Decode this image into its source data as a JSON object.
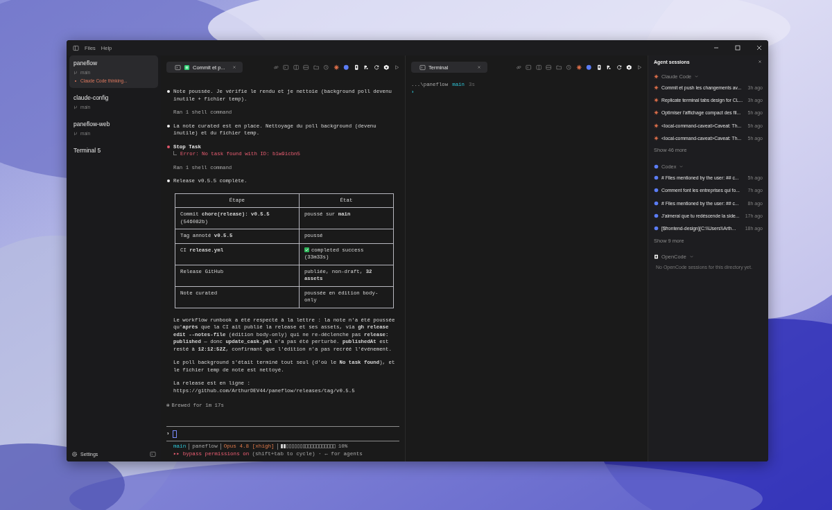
{
  "menu": [
    "Files",
    "Help"
  ],
  "sidebar": {
    "projects": [
      {
        "name": "paneflow",
        "branch": "main",
        "status": "Claude Code thinking...",
        "selected": true
      },
      {
        "name": "claude-config",
        "branch": "main",
        "selected": false
      },
      {
        "name": "paneflow-web",
        "branch": "main",
        "selected": false
      },
      {
        "name": "Terminal 5",
        "selected": false
      }
    ],
    "settings": "Settings"
  },
  "left_pane": {
    "tab": {
      "title": "Commit et p..."
    },
    "blocks": [
      {
        "kind": "message",
        "text": "Note poussée. Je vérifie le rendu et je nettoie (background poll devenu inutile + fichier temp)."
      },
      {
        "kind": "note",
        "text": "Ran 1 shell command"
      },
      {
        "kind": "message",
        "text": "La note curated est en place. Nettoyage du poll background (devenu inutile) et du fichier temp."
      },
      {
        "kind": "tool",
        "text": "Stop Task",
        "error": "Error: No task found with ID: b1w9icbn5"
      },
      {
        "kind": "note",
        "text": "Ran 1 shell command"
      },
      {
        "kind": "message",
        "text": "Release v0.5.5 complète."
      },
      {
        "kind": "table",
        "columns": [
          "Étape",
          "État"
        ],
        "rows": [
          {
            "step": "Commit **chore(release): v0.5.5** (546082b)",
            "state": "poussé sur **main**",
            "check": false
          },
          {
            "step": "Tag annoté **v0.5.5**",
            "state": "poussé",
            "check": false
          },
          {
            "step": "CI **release.yml**",
            "state": "completed success (33m33s)",
            "check": true
          },
          {
            "step": "Release GitHub",
            "state": "publiée, non-draft, **32 assets**",
            "check": false
          },
          {
            "step": "Note curated",
            "state": "poussée en édition body-only",
            "check": false
          }
        ]
      },
      {
        "kind": "paragraph",
        "text": "Le workflow runbook a été respecté à la lettre : la note n'a été poussée qu'**après** que la CI ait publié la release et ses assets, via **gh release edit --notes-file** (édition body-only) qui ne re-déclenche pas **release: published** — donc **update_cask.yml** n'a pas été perturbé. **publishedAt** est resté à **12:12:52Z**, confirmant que l'édition n'a pas recréé l'événement."
      },
      {
        "kind": "paragraph",
        "text": "Le poll background s'était terminé tout seul (d'où le **No task found**), et le fichier temp de note est nettoyé."
      },
      {
        "kind": "paragraph",
        "text": "La release est en ligne :\nhttps://github.com/ArthurDEV44/paneflow/releases/tag/v0.5.5"
      },
      {
        "kind": "brewed",
        "glyph": "✻",
        "text": "Brewed for 1m 17s"
      }
    ],
    "prompt": "›",
    "status_line": {
      "branch": "main",
      "project": "paneflow",
      "model": "Opus 4.8 [xhigh]",
      "context": {
        "level": 0.1,
        "reading": "10%"
      }
    },
    "mode_line": {
      "mode": "▸▸ bypass permissions on",
      "hint": "(shift+tab to cycle) · ← for agents"
    }
  },
  "right_pane": {
    "tab": {
      "title": "Terminal"
    },
    "path": "...\\paneflow",
    "branch": "main",
    "time": "3s",
    "prompt": "›"
  },
  "agent_sessions": {
    "title": "Agent sessions",
    "groups": [
      {
        "name": "Claude Code",
        "kind": "claude",
        "sessions": [
          {
            "title": "Commit et push les changements av...",
            "time": "3h ago"
          },
          {
            "title": "Replicate terminal tabs design for CL...",
            "time": "3h ago"
          },
          {
            "title": "Optimiser l'affichage compact des fil...",
            "time": "5h ago"
          },
          {
            "title": "<local-command-caveat>Caveat: Th...",
            "time": "5h ago"
          },
          {
            "title": "<local-command-caveat>Caveat: Th...",
            "time": "5h ago"
          }
        ],
        "more": "Show 46 more"
      },
      {
        "name": "Codex",
        "kind": "codex",
        "sessions": [
          {
            "title": "# Files mentioned by the user: ## c...",
            "time": "5h ago"
          },
          {
            "title": "Comment font les entreprises qui fo...",
            "time": "7h ago"
          },
          {
            "title": "# Files mentioned by the user: ## c...",
            "time": "8h ago"
          },
          {
            "title": "J'aimerai que tu redéscende la side...",
            "time": "17h ago"
          },
          {
            "title": "[$frontend-design](C:\\\\Users\\\\Arth...",
            "time": "18h ago"
          }
        ],
        "more": "Show 9 more"
      },
      {
        "name": "OpenCode",
        "kind": "opencode",
        "empty": "No OpenCode sessions for this directory yet."
      }
    ]
  }
}
